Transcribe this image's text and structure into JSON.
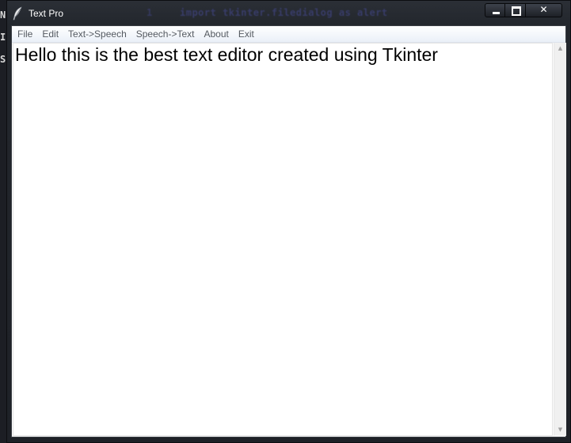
{
  "window": {
    "title": "Text Pro",
    "background_code_text": "import tkinter.filedialog as alert",
    "background_code_prefix": "1",
    "left_glyphs": [
      "N",
      "I",
      "S"
    ],
    "controls": {
      "minimize": "minimize",
      "maximize": "maximize",
      "close": "✕"
    }
  },
  "menu": {
    "items": [
      "File",
      "Edit",
      "Text->Speech",
      "Speech->Text",
      "About",
      "Exit"
    ]
  },
  "editor": {
    "content": "Hello this is the best text editor created using Tkinter"
  },
  "scrollbar": {
    "up": "▲",
    "down": "▼"
  },
  "colors": {
    "titlebar": "#23272d",
    "menubar": "#eaf0f8",
    "editor_bg": "#ffffff"
  }
}
